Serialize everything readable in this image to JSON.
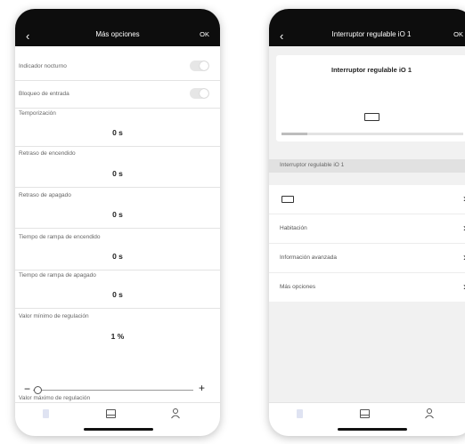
{
  "left_screen": {
    "header": {
      "back_icon": "chevron-left-icon",
      "title": "Más opciones",
      "ok": "OK"
    },
    "settings": {
      "night_indicator": {
        "label": "Indicador nocturno",
        "enabled": false
      },
      "input_lock": {
        "label": "Bloqueo de entrada",
        "enabled": false
      },
      "timer": {
        "label": "Temporización",
        "value": "0 s"
      },
      "on_delay": {
        "label": "Retraso de encendido",
        "value": "0 s"
      },
      "off_delay": {
        "label": "Retraso de apagado",
        "value": "0 s"
      },
      "ramp_on": {
        "label": "Tiempo de rampa de encendido",
        "value": "0 s"
      },
      "ramp_off": {
        "label": "Tiempo de rampa de apagado",
        "value": "0 s"
      },
      "min_dim": {
        "label": "Valor mínimo de regulación",
        "value": "1 %"
      },
      "slider": {
        "minus": "−",
        "plus": "+",
        "level_percent": 1
      },
      "max_dim": {
        "label": "Valor máximo de regulación"
      }
    },
    "tabbar": {
      "tabs": [
        "devices-icon",
        "rooms-icon",
        "profile-icon"
      ]
    }
  },
  "right_screen": {
    "header": {
      "back_icon": "chevron-left-icon",
      "title": "Interruptor regulable iO 1",
      "ok": "OK"
    },
    "card": {
      "title": "Interruptor regulable iO 1",
      "icon": "dimmer-switch-icon",
      "progress_fraction": 0.14
    },
    "name_field": "Interruptor regulable iO 1",
    "rows": [
      {
        "label": "",
        "icon": "dimmer-switch-icon"
      },
      {
        "label": "Habitación"
      },
      {
        "label": "Información avanzada"
      },
      {
        "label": "Más opciones"
      }
    ],
    "tabbar": {
      "tabs": [
        "devices-icon",
        "rooms-icon",
        "profile-icon"
      ]
    }
  }
}
